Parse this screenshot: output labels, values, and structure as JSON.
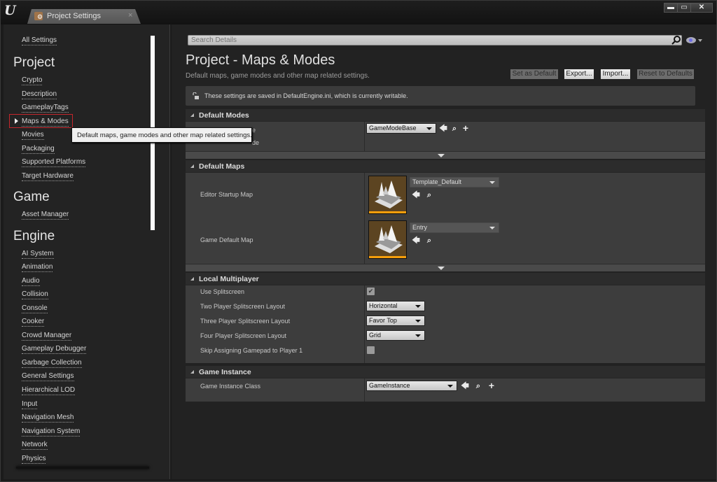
{
  "window": {
    "tab_title": "Project Settings",
    "tab_close": "×",
    "controls": {
      "minimize": "▬",
      "maximize": "▭",
      "close": "✕"
    }
  },
  "sidebar": {
    "all_settings": "All Settings",
    "sections": [
      {
        "title": "Project",
        "items": [
          "Crypto",
          "Description",
          "GameplayTags",
          "Maps & Modes",
          "Movies",
          "Packaging",
          "Supported Platforms",
          "Target Hardware"
        ]
      },
      {
        "title": "Game",
        "items": [
          "Asset Manager"
        ]
      },
      {
        "title": "Engine",
        "items": [
          "AI System",
          "Animation",
          "Audio",
          "Collision",
          "Console",
          "Cooker",
          "Crowd Manager",
          "Gameplay Debugger",
          "Garbage Collection",
          "General Settings",
          "Hierarchical LOD",
          "Input",
          "Navigation Mesh",
          "Navigation System",
          "Network",
          "Physics"
        ]
      }
    ],
    "selected": "Maps & Modes",
    "tooltip": "Default maps, game modes and other map related settings."
  },
  "main": {
    "search_placeholder": "Search Details",
    "title": "Project - Maps & Modes",
    "description": "Default maps, game modes and other map related settings.",
    "buttons": {
      "set_default": "Set as Default",
      "export": "Export...",
      "import": "Import...",
      "reset": "Reset to Defaults"
    },
    "notice": "These settings are saved in DefaultEngine.ini, which is currently writable.",
    "sections": {
      "default_modes": {
        "title": "Default Modes",
        "label_partial_1": "e",
        "label_partial_2": "de",
        "value": "GameModeBase"
      },
      "default_maps": {
        "title": "Default Maps",
        "rows": [
          {
            "label": "Editor Startup Map",
            "value": "Template_Default"
          },
          {
            "label": "Game Default Map",
            "value": "Entry"
          }
        ]
      },
      "local_multiplayer": {
        "title": "Local Multiplayer",
        "rows": [
          {
            "label": "Use Splitscreen",
            "checked": true
          },
          {
            "label": "Two Player Splitscreen Layout",
            "value": "Horizontal"
          },
          {
            "label": "Three Player Splitscreen Layout",
            "value": "Favor Top"
          },
          {
            "label": "Four Player Splitscreen Layout",
            "value": "Grid"
          },
          {
            "label": "Skip Assigning Gamepad to Player 1",
            "checked": false
          }
        ]
      },
      "game_instance": {
        "title": "Game Instance",
        "label": "Game Instance Class",
        "value": "GameInstance"
      }
    },
    "icons": {
      "use_selected": "🡄",
      "browse": "⌕",
      "add": "+",
      "check": "✔"
    }
  }
}
